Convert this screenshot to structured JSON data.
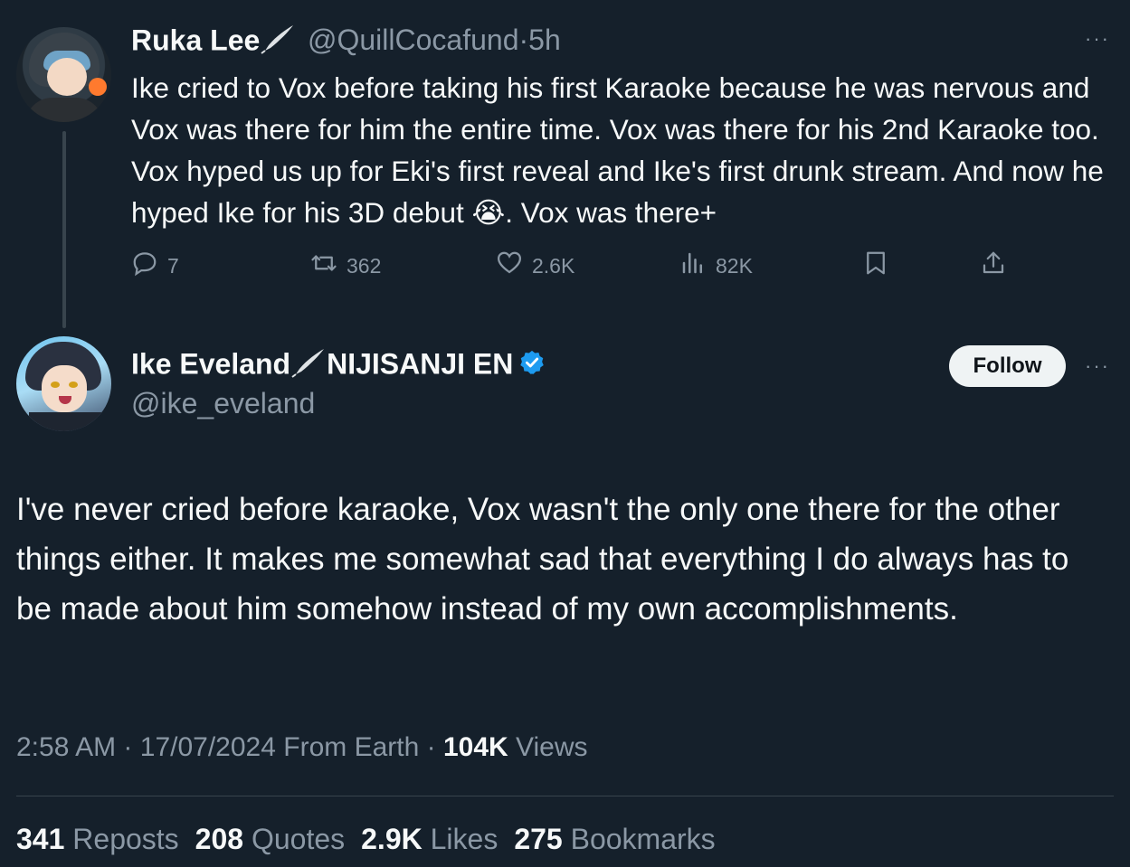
{
  "parent_tweet": {
    "name": "Ruka Lee",
    "handle": "@QuillCocafund",
    "separator": "·",
    "time": "5h",
    "more": "···",
    "text_before_emoji": "Ike cried to Vox before taking his first Karaoke because he was nervous and Vox was there for him the entire time. Vox was there for his 2nd Karaoke too. Vox hyped us up for Eki's first reveal and Ike's first drunk stream. And now he hyped Ike for his 3D debut ",
    "emoji": "😭",
    "text_after_emoji": ". Vox was there+",
    "actions": {
      "replies": "7",
      "reposts": "362",
      "likes": "2.6K",
      "views": "82K"
    }
  },
  "main_tweet": {
    "name": "Ike Eveland",
    "name_suffix": "NIJISANJI EN",
    "handle": "@ike_eveland",
    "follow_label": "Follow",
    "more": "···",
    "text": "I've never cried before karaoke, Vox wasn't the only one there for the other things either. It makes me somewhat sad that everything I do always has to be made about him somehow instead of my own accomplishments.",
    "meta": {
      "time": "2:58 AM",
      "sep1": "·",
      "date": "17/07/2024",
      "location": "From Earth",
      "sep2": "·",
      "views_count": "104K",
      "views_label": "Views"
    },
    "stats": {
      "reposts_count": "341",
      "reposts_label": "Reposts",
      "quotes_count": "208",
      "quotes_label": "Quotes",
      "likes_count": "2.9K",
      "likes_label": "Likes",
      "bookmarks_count": "275",
      "bookmarks_label": "Bookmarks"
    }
  },
  "icons": {
    "reply": "reply-icon",
    "repost": "repost-icon",
    "like": "heart-icon",
    "views": "views-icon",
    "bookmark": "bookmark-icon",
    "share": "share-icon",
    "verified": "verified-badge-icon",
    "quill": "quill-pen-icon"
  },
  "colors": {
    "background": "#15202b",
    "text": "#f7f9f9",
    "muted": "#8b98a5",
    "verified": "#1d9bf0"
  }
}
